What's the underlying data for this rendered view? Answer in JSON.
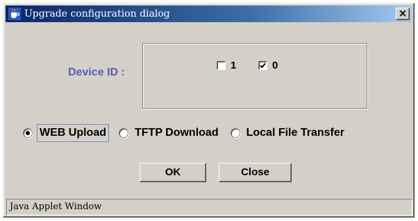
{
  "window": {
    "title": "Upgrade configuration dialog",
    "close_glyph": "×",
    "icon": "java-cup-icon"
  },
  "device": {
    "label": "Device ID :",
    "checkboxes": [
      {
        "label": "1",
        "checked": false
      },
      {
        "label": "0",
        "checked": true
      }
    ]
  },
  "upload_modes": {
    "selected": "WEB Upload",
    "options": [
      "WEB Upload",
      "TFTP Download",
      "Local File Transfer"
    ]
  },
  "buttons": {
    "ok": "OK",
    "close": "Close"
  },
  "status_bar": {
    "text": "Java Applet Window"
  },
  "colors": {
    "label_accent": "#5b5bb8",
    "title_gradient_start": "#0a246a",
    "title_gradient_end": "#a6caf0"
  }
}
